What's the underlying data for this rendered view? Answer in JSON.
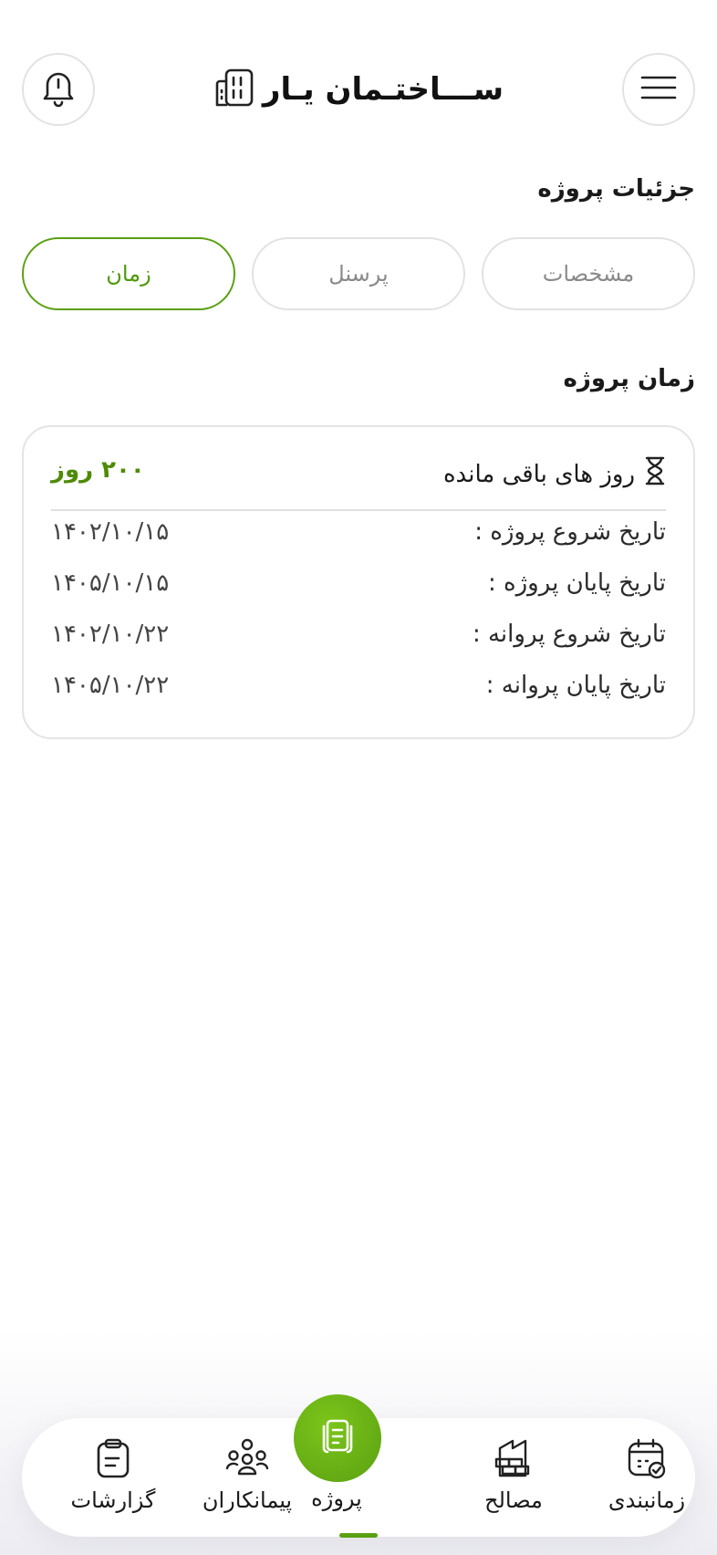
{
  "header": {
    "app_name": "ســـاختـمان یـار",
    "icons": {
      "notifications": "bell-icon",
      "menu": "hamburger-icon",
      "logo": "building-icon"
    }
  },
  "details": {
    "title": "جزئیات پروژه",
    "tabs": [
      {
        "label": "زمان",
        "active": true
      },
      {
        "label": "پرسنل",
        "active": false
      },
      {
        "label": "مشخصات",
        "active": false
      }
    ]
  },
  "time_section": {
    "title": "زمان پروژه",
    "remaining_label": "روز های باقی مانده",
    "remaining_icon": "hourglass-icon",
    "remaining_value": "۲۰۰ روز",
    "rows": [
      {
        "label": "تاریخ شروع پروژه :",
        "value": "۱۴۰۲/۱۰/۱۵"
      },
      {
        "label": "تاریخ پایان پروژه :",
        "value": "۱۴۰۵/۱۰/۱۵"
      },
      {
        "label": "تاریخ شروع پروانه :",
        "value": "۱۴۰۲/۱۰/۲۲"
      },
      {
        "label": "تاریخ پایان پروانه :",
        "value": "۱۴۰۵/۱۰/۲۲"
      }
    ]
  },
  "bottom_nav": {
    "items": [
      {
        "label": "گزارشات",
        "icon": "clipboard-icon"
      },
      {
        "label": "پیمانکاران",
        "icon": "people-group-icon"
      },
      {
        "label": "پروژه",
        "icon": "document-icon",
        "active": true
      },
      {
        "label": "مصالح",
        "icon": "bricks-icon"
      },
      {
        "label": "زمانبندی",
        "icon": "calendar-check-icon"
      }
    ]
  },
  "colors": {
    "accent": "#5aa012",
    "accent_text": "#4e8a06",
    "border": "#e2e2e2"
  }
}
